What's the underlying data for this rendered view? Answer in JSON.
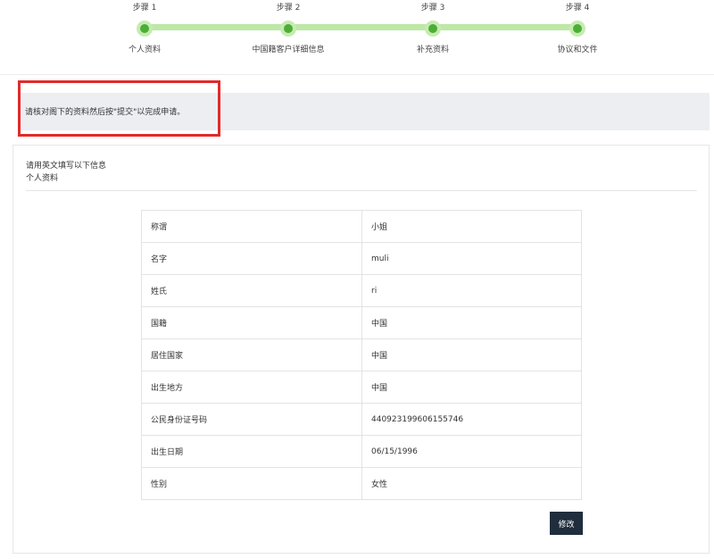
{
  "stepper": {
    "steps": [
      {
        "number": "步骤 1",
        "label": "个人资料"
      },
      {
        "number": "步骤 2",
        "label": "中国籍客户详细信息"
      },
      {
        "number": "步骤 3",
        "label": "补充资料"
      },
      {
        "number": "步骤 4",
        "label": "协议和文件"
      }
    ],
    "accent_color": "#4cae36",
    "track_color": "#bde8a5"
  },
  "notice": {
    "text": "请核对阁下的资料然后按\"提交\"以完成申请。",
    "highlight_color": "#e02b2b"
  },
  "card": {
    "instruction": "请用英文填写以下信息",
    "section_title": "个人资料",
    "rows": [
      {
        "label": "称谓",
        "value": "小姐"
      },
      {
        "label": "名字",
        "value": "muli"
      },
      {
        "label": "姓氏",
        "value": "ri"
      },
      {
        "label": "国籍",
        "value": "中国"
      },
      {
        "label": "居住国家",
        "value": "中国"
      },
      {
        "label": "出生地方",
        "value": "中国"
      },
      {
        "label": "公民身份证号码",
        "value": "440923199606155746"
      },
      {
        "label": "出生日期",
        "value": "06/15/1996"
      },
      {
        "label": "性别",
        "value": "女性"
      }
    ],
    "edit_label": "修改"
  }
}
